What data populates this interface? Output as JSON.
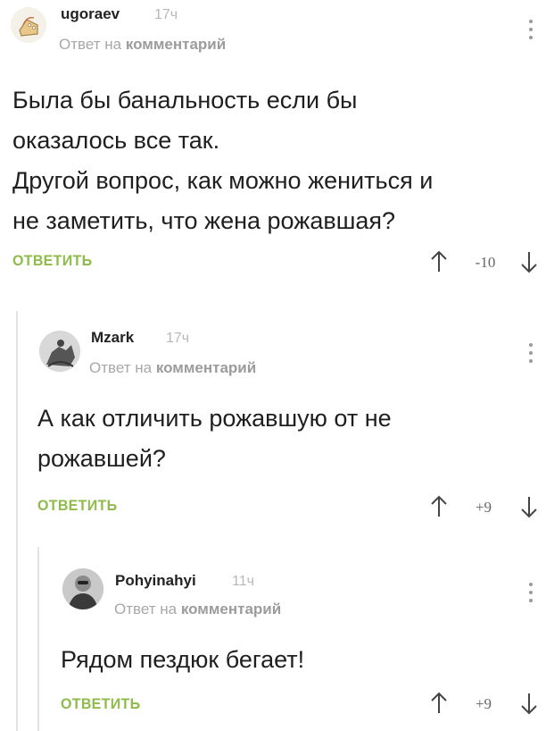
{
  "comments": [
    {
      "username": "ugoraev",
      "time": "17ч",
      "reply_prefix": "Ответ на",
      "reply_target": "комментарий",
      "lines": [
        "Была бы банальность если бы",
        "оказалось все так.",
        "Другой вопрос, как можно жениться и",
        "не заметить, что жена рожавшая?"
      ],
      "reply_label": "ОТВЕТИТЬ",
      "rating": "-10"
    },
    {
      "username": "Mzark",
      "time": "17ч",
      "reply_prefix": "Ответ на",
      "reply_target": "комментарий",
      "lines": [
        "А как отличить рожавшую от не",
        "рожавшей?"
      ],
      "reply_label": "ОТВЕТИТЬ",
      "rating": "+9"
    },
    {
      "username": "Pohyinahyi",
      "time": "11ч",
      "reply_prefix": "Ответ на",
      "reply_target": "комментарий",
      "lines": [
        "Рядом пездюк бегает!"
      ],
      "reply_label": "ОТВЕТИТЬ",
      "rating": "+9"
    }
  ],
  "colors": {
    "accent_green": "#8fbb4a",
    "muted_text": "#a8a8a8",
    "thread_line": "#e3e3e3"
  },
  "icons": {
    "vote_up": "arrow-up-icon",
    "vote_down": "arrow-down-icon",
    "menu": "vertical-dots-icon"
  }
}
